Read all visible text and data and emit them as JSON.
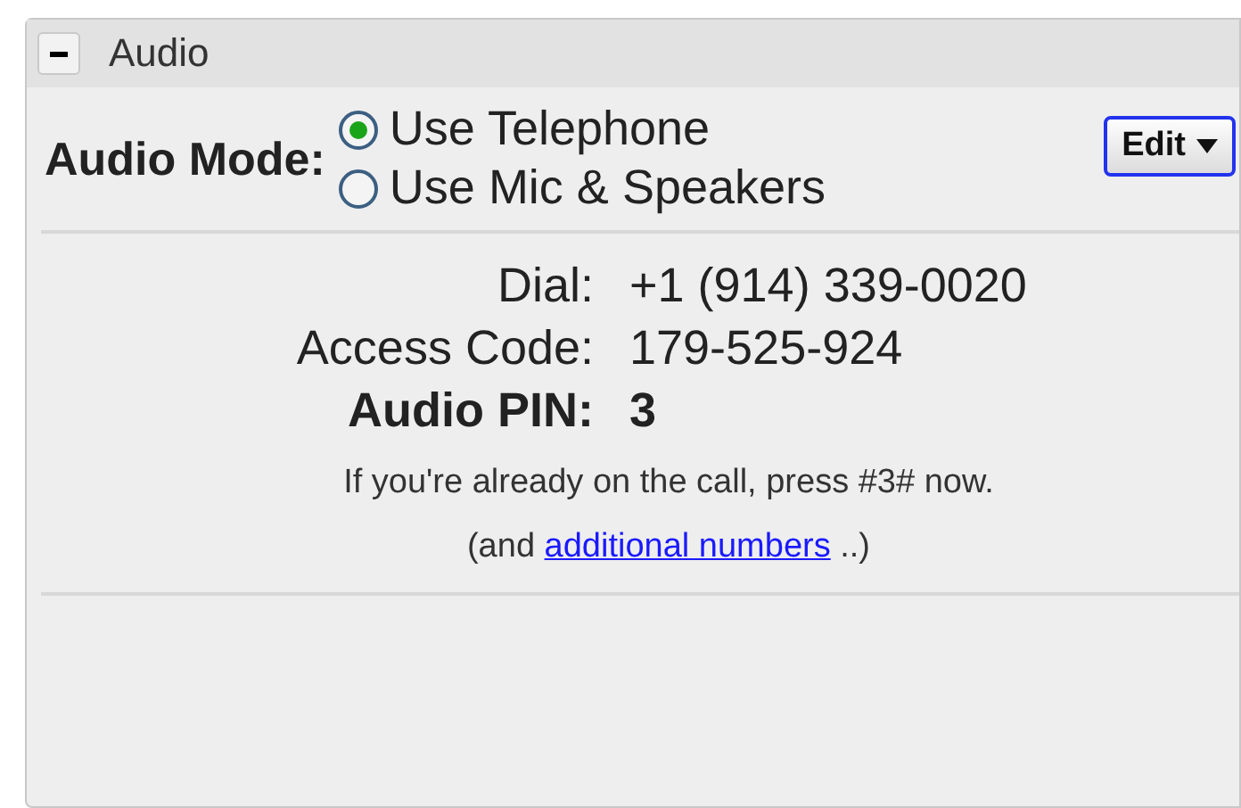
{
  "section": {
    "title": "Audio",
    "expanded": true
  },
  "audio_mode": {
    "label": "Audio Mode:",
    "options": [
      {
        "label": "Use Telephone",
        "selected": true
      },
      {
        "label": "Use Mic & Speakers",
        "selected": false
      }
    ],
    "edit_button": "Edit"
  },
  "details": [
    {
      "label": "Dial:",
      "value": "+1 (914) 339-0020",
      "kind": "plain"
    },
    {
      "label": "Access Code:",
      "value": "179-525-924",
      "kind": "plain"
    },
    {
      "label": "Audio PIN:",
      "value": "3",
      "kind": "emphasis"
    }
  ],
  "note": "If you're already on the call, press #3# now.",
  "more": {
    "before": "(and",
    "link": "additional numbers",
    "after": "..)"
  }
}
